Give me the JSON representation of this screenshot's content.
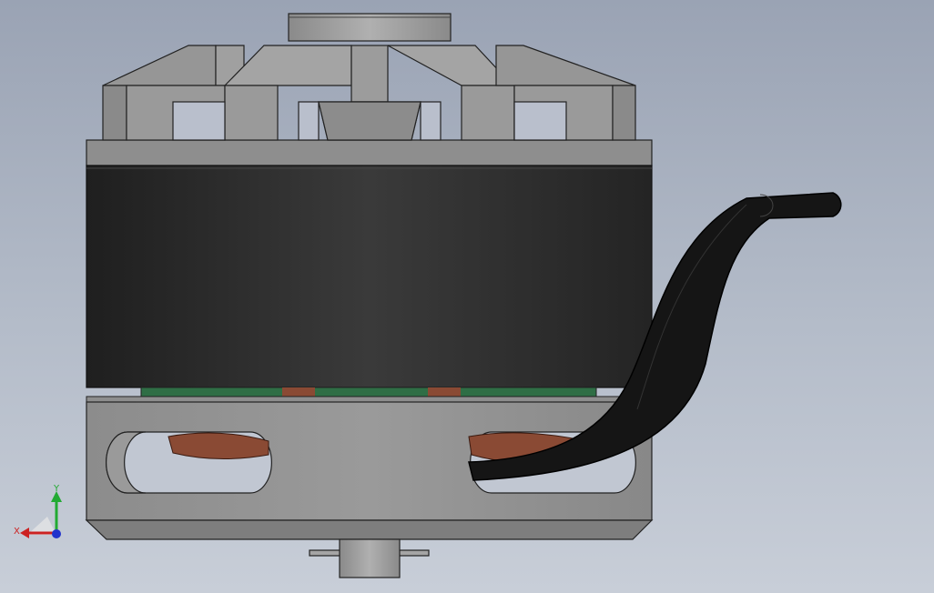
{
  "viewport": {
    "background_top": "#9aa3b4",
    "background_bottom": "#c8ced8"
  },
  "model": {
    "type": "brushless-outrunner-motor",
    "view": "front",
    "colors": {
      "housing_metal": "#8a8a8a",
      "housing_light": "#a2a2a2",
      "housing_dark": "#6e6e6e",
      "rotor_bell": "#2c2c2c",
      "windings_copper": "#8a4a34",
      "stator_green": "#2f6e45",
      "cable": "#141414",
      "edge_line": "#222222"
    }
  },
  "triad": {
    "x_label": "X",
    "y_label": "Y",
    "x_color": "#cc2222",
    "y_color": "#22aa33",
    "z_color": "#2233cc"
  }
}
